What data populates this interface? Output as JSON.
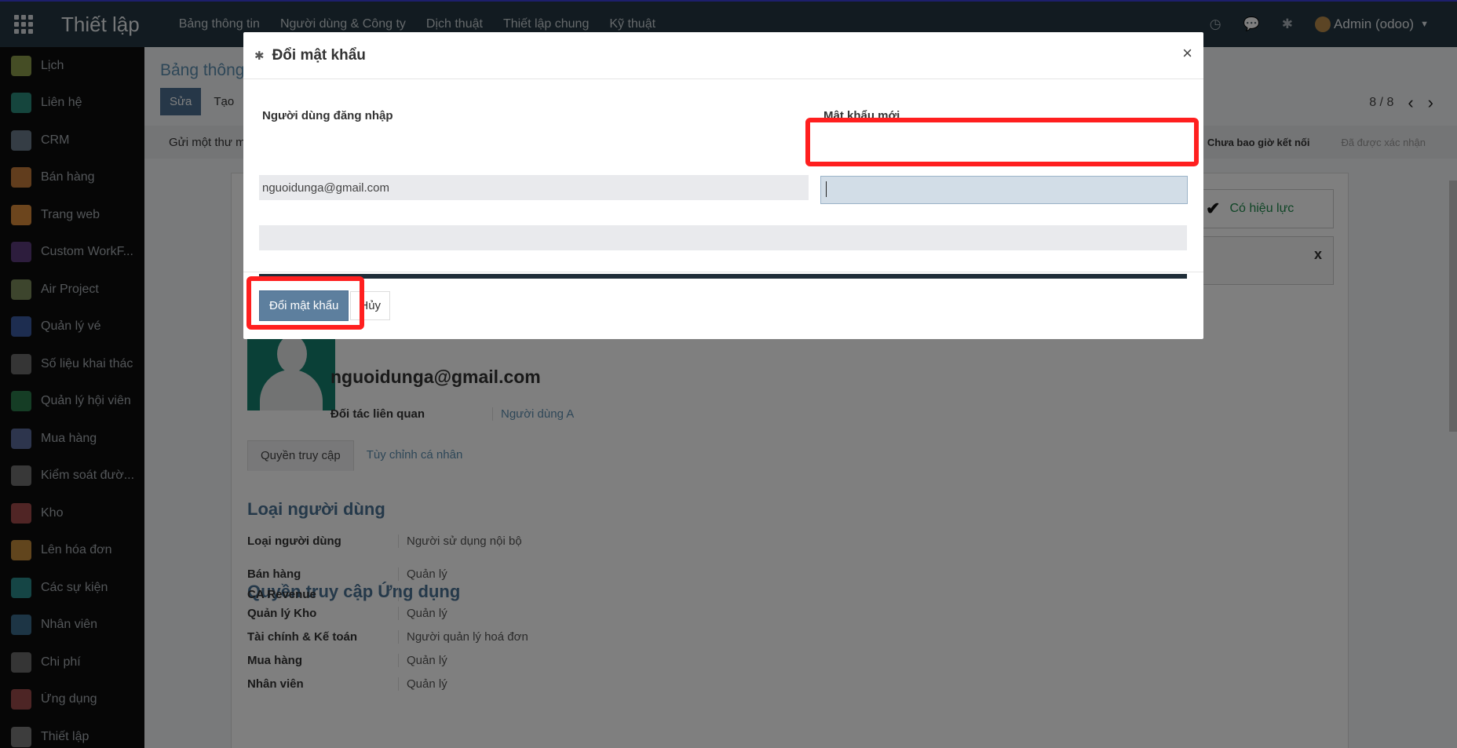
{
  "navbar": {
    "brand": "Thiết lập",
    "menu": [
      "Bảng thông tin",
      "Người dùng & Công ty",
      "Dịch thuật",
      "Thiết lập chung",
      "Kỹ thuật"
    ],
    "user": "Admin (odoo)"
  },
  "sidebar": {
    "items": [
      {
        "label": "Lịch",
        "color": "#8a9a4a"
      },
      {
        "label": "Liên hệ",
        "color": "#2a8a7a"
      },
      {
        "label": "CRM",
        "color": "#6a7b8a"
      },
      {
        "label": "Bán hàng",
        "color": "#c27a3a"
      },
      {
        "label": "Trang web",
        "color": "#d98a3a"
      },
      {
        "label": "Custom WorkF...",
        "color": "#5a3a7a"
      },
      {
        "label": "Air Project",
        "color": "#7a8a5a"
      },
      {
        "label": "Quản lý vé",
        "color": "#3a5aa0"
      },
      {
        "label": "Số liệu khai thác",
        "color": "#6a6a6a"
      },
      {
        "label": "Quản lý hội viên",
        "color": "#2a7a4a"
      },
      {
        "label": "Mua hàng",
        "color": "#5a6a9a"
      },
      {
        "label": "Kiểm soát đườ...",
        "color": "#707070"
      },
      {
        "label": "Kho",
        "color": "#a04a4a"
      },
      {
        "label": "Lên hóa đơn",
        "color": "#c28a3a"
      },
      {
        "label": "Các sự kiện",
        "color": "#2a8a8a"
      },
      {
        "label": "Nhân viên",
        "color": "#3a6a8a"
      },
      {
        "label": "Chi phí",
        "color": "#6a6a6a"
      },
      {
        "label": "Ứng dụng",
        "color": "#9a4a4a"
      },
      {
        "label": "Thiết lập",
        "color": "#7a7a7a"
      }
    ]
  },
  "main": {
    "breadcrumb": "Bảng thông",
    "edit_label": "Sửa",
    "create_label": "Tạo",
    "pager": "8 / 8",
    "send_mail": "Gửi một thư m",
    "stage_current": "Chưa bao giờ kết nối",
    "stage_next": "Đã được xác nhận",
    "valid_label": "Có hiệu lực",
    "alert_close": "x",
    "email": "nguoidunga@gmail.com",
    "related_partner_label": "Đối tác liên quan",
    "related_partner_value": "Người dùng A",
    "tabs": [
      "Quyền truy cập",
      "Tùy chỉnh cá nhân"
    ],
    "user_type_section": "Loại người dùng",
    "user_type_label": "Loại người dùng",
    "user_type_value": "Người sử dụng nội bộ",
    "app_access_section": "Quyền truy cập Ứng dụng",
    "access_rows": [
      {
        "label": "Bán hàng",
        "value": "Quản lý"
      },
      {
        "label": "CA Revenue",
        "value": ""
      },
      {
        "label": "Quản lý Kho",
        "value": "Quản lý"
      },
      {
        "label": "Tài chính & Kế toán",
        "value": "Người quản lý hoá đơn"
      },
      {
        "label": "Mua hàng",
        "value": "Quản lý"
      },
      {
        "label": "Nhân viên",
        "value": "Quản lý"
      }
    ]
  },
  "modal": {
    "title": "Đổi mật khẩu",
    "close": "×",
    "col_login": "Người dùng đăng nhập",
    "col_new_password": "Mật khẩu mới",
    "login_value": "nguoidunga@gmail.com",
    "new_password_value": "",
    "submit_label": "Đổi mật khẩu",
    "cancel_label": "Hủy"
  }
}
